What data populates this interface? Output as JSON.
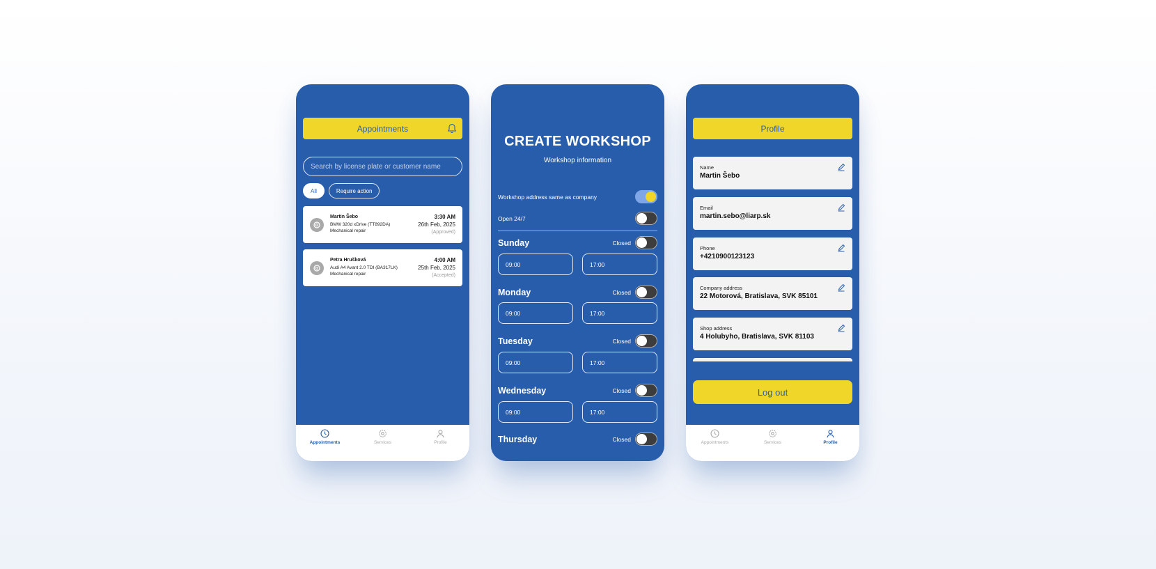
{
  "appointments_screen": {
    "header_title": "Appointments",
    "search_placeholder": "Search by license plate or customer name",
    "filters": [
      "All",
      "Require action"
    ],
    "cards": [
      {
        "name": "Martin Šebo",
        "car": "BMW 320d xDrive (TT892DA)",
        "service": "Mechanical repair",
        "time": "3:30 AM",
        "date": "26th Feb, 2025",
        "status": "(Approved)"
      },
      {
        "name": "Petra Hrušková",
        "car": "Audi A4 Avant 2.0 TDI (BA317LK)",
        "service": "Mechanical repair",
        "time": "4:00 AM",
        "date": "25th Feb, 2025",
        "status": "(Accepted)"
      }
    ]
  },
  "workshop_screen": {
    "title": "CREATE WORKSHOP",
    "subtitle": "Workshop information",
    "address_same_label": "Workshop address same as company",
    "open_247_label": "Open 24/7",
    "closed_label": "Closed",
    "days": [
      {
        "name": "Sunday",
        "open": "09:00",
        "close": "17:00"
      },
      {
        "name": "Monday",
        "open": "09:00",
        "close": "17:00"
      },
      {
        "name": "Tuesday",
        "open": "09:00",
        "close": "17:00"
      },
      {
        "name": "Wednesday",
        "open": "09:00",
        "close": "17:00"
      },
      {
        "name": "Thursday"
      }
    ]
  },
  "profile_screen": {
    "header_title": "Profile",
    "fields": [
      {
        "label": "Name",
        "value": "Martin Šebo"
      },
      {
        "label": "Email",
        "value": "martin.sebo@liarp.sk"
      },
      {
        "label": "Phone",
        "value": "+4210900123123"
      },
      {
        "label": "Company address",
        "value": "22 Motorová, Bratislava, SVK 85101"
      },
      {
        "label": "Shop address",
        "value": "4 Holubyho, Bratislava, SVK 81103"
      }
    ],
    "logout_label": "Log out"
  },
  "nav": {
    "appointments": "Appointments",
    "services": "Services",
    "profile": "Profile"
  },
  "colors": {
    "primary_blue": "#285dab",
    "accent_yellow": "#f0d628"
  }
}
